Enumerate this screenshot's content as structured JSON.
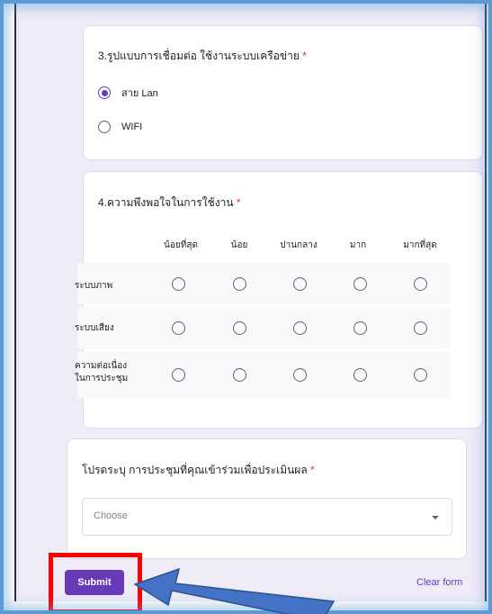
{
  "q3": {
    "title": "3.รูปแบบการเชื่อมต่อ ใช้งานระบบเครือข่าย",
    "required_mark": "*",
    "options": [
      {
        "label": "สาย Lan",
        "selected": true
      },
      {
        "label": "WIFI",
        "selected": false
      }
    ]
  },
  "q4": {
    "title": "4.ความพึงพอใจในการใช้งาน",
    "required_mark": "*",
    "columns": [
      "น้อยที่สุด",
      "น้อย",
      "ปานกลาง",
      "มาก",
      "มากที่สุด"
    ],
    "rows": [
      {
        "label": "ระบบภาพ"
      },
      {
        "label": "ระบบเสียง"
      },
      {
        "label_line1": "ความต่อเนื่อง",
        "label_line2": "ในการประชุม"
      }
    ]
  },
  "q5": {
    "title": "โปรดระบุ การประชุมที่คุณเข้าร่วมเพื่อประเมินผล",
    "required_mark": "*",
    "select_placeholder": "Choose"
  },
  "actions": {
    "submit_label": "Submit",
    "clear_label": "Clear form"
  },
  "colors": {
    "accent": "#673ab7",
    "required": "#d93025",
    "page_background": "#efebf7",
    "highlight_box": "#ff0000",
    "arrow": "#4472c4"
  },
  "icons": [
    "radio-checked-icon",
    "radio-unchecked-icon",
    "chevron-down-icon",
    "pointer-arrow-icon"
  ]
}
